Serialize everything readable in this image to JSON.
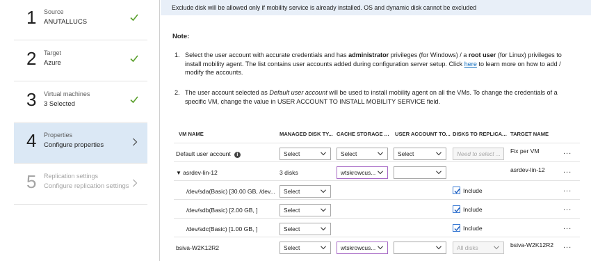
{
  "steps": [
    {
      "num": "1",
      "title": "Source",
      "subtitle": "ANUTALLUCS",
      "state": "done"
    },
    {
      "num": "2",
      "title": "Target",
      "subtitle": "Azure",
      "state": "done"
    },
    {
      "num": "3",
      "title": "Virtual machines",
      "subtitle": "3 Selected",
      "state": "done"
    },
    {
      "num": "4",
      "title": "Properties",
      "subtitle": "Configure properties",
      "state": "active"
    },
    {
      "num": "5",
      "title": "Replication settings",
      "subtitle": "Configure replication settings",
      "state": "disabled"
    }
  ],
  "banner": "Exclude disk will be allowed only if mobility service is already installed. OS and dynamic disk cannot be excluded",
  "note": {
    "title": "Note:",
    "item1_num": "1.",
    "item1_a": "Select the user account with accurate credentials and has ",
    "item1_b": "administrator",
    "item1_c": " privileges (for Windows) / a ",
    "item1_d": "root user",
    "item1_e": " (for Linux) privileges to install mobility agent. The list contains user accounts added during configuration server setup. Click ",
    "item1_link": "here",
    "item1_f": " to learn more on how to add / modify the accounts.",
    "item2_num": "2.",
    "item2_a": "The user account selected as ",
    "item2_b": "Default user account",
    "item2_c": " will be used to install mobility agent on all the VMs. To change the credentials of a specific VM, change the value in USER ACCOUNT TO INSTALL MOBILITY SERVICE field."
  },
  "columns": [
    "VM NAME",
    "MANAGED DISK TY...",
    "CACHE STORAGE A...",
    "USER ACCOUNT TO...",
    "DISKS TO REPLICATE",
    "TARGET NAME"
  ],
  "rows": {
    "default": {
      "name": "Default user account",
      "managed": "Select",
      "cache": "Select",
      "account": "Select",
      "disks": "Need to select ...",
      "target": "Fix per VM"
    },
    "vm1": {
      "name": "asrdev-lin-12",
      "managed": "3 disks",
      "cache": "wtskrowcus...",
      "account": "",
      "target": "asrdev-lin-12"
    },
    "disk1": {
      "name": "/dev/sda(Basic) [30.00 GB, /dev...",
      "managed": "Select",
      "include": "Include"
    },
    "disk2": {
      "name": "/dev/sdb(Basic) [2.00 GB, ]",
      "managed": "Select",
      "include": "Include"
    },
    "disk3": {
      "name": "/dev/sdc(Basic) [1.00 GB, ]",
      "managed": "Select",
      "include": "Include"
    },
    "vm2": {
      "name": "bsiva-W2K12R2",
      "managed": "Select",
      "cache": "wtskrowcus...",
      "account": "",
      "disks": "All disks",
      "target": "bsiva-W2K12R2"
    }
  },
  "more_label": "...",
  "colors": {
    "check": "#5aa02c",
    "active_step": "#dbe8f5",
    "banner": "#e8eff8",
    "link": "#0f6cbd",
    "cache_border": "#a86bc6"
  }
}
